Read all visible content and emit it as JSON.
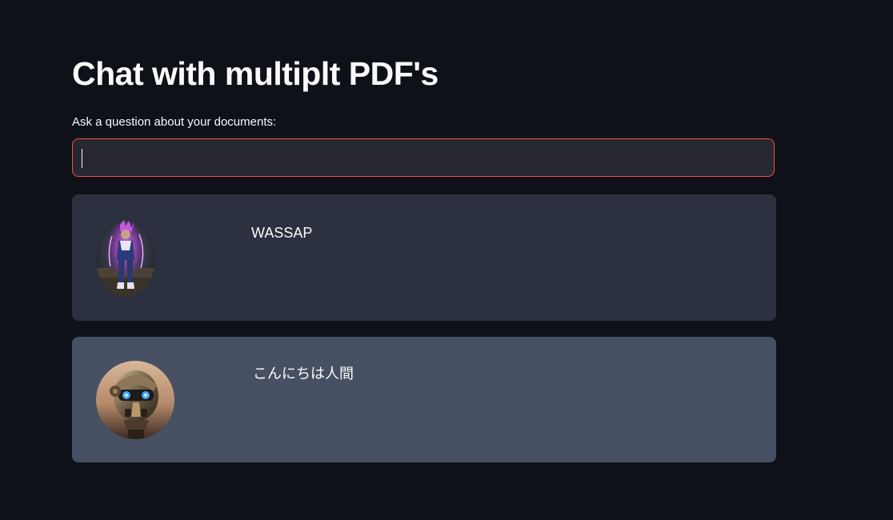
{
  "page": {
    "title": "Chat with multiplt PDF's"
  },
  "question": {
    "label": "Ask a question about your documents:",
    "value": "",
    "placeholder": ""
  },
  "messages": [
    {
      "role": "user",
      "avatar": "user-avatar-image",
      "text": "WASSAP"
    },
    {
      "role": "bot",
      "avatar": "bot-avatar-image",
      "text": "こんにちは人間"
    }
  ],
  "colors": {
    "background": "#0e1117",
    "input_background": "#262730",
    "input_border": "#ff4b4b",
    "user_message_background": "#2b313e",
    "bot_message_background": "#475063",
    "text": "#fafafa"
  }
}
